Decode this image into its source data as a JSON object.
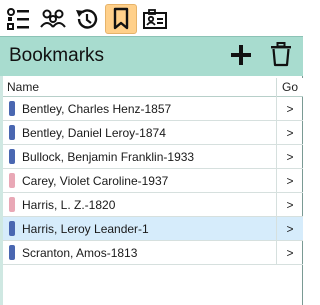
{
  "tabs": [
    {
      "icon": "list-icon"
    },
    {
      "icon": "people-icon"
    },
    {
      "icon": "history-icon"
    },
    {
      "icon": "bookmark-icon",
      "active": true
    },
    {
      "icon": "id-card-icon"
    }
  ],
  "header": {
    "title": "Bookmarks",
    "add_icon": "plus-icon",
    "delete_icon": "trash-icon"
  },
  "table": {
    "columns": [
      "Name",
      "Go"
    ],
    "rows": [
      {
        "label": "Bentley, Charles Henz-1857",
        "color": "#4a67b1",
        "go": ">"
      },
      {
        "label": "Bentley, Daniel Leroy-1874",
        "color": "#4a67b1",
        "go": ">"
      },
      {
        "label": "Bullock, Benjamin Franklin-1933",
        "color": "#4a67b1",
        "go": ">"
      },
      {
        "label": "Carey, Violet Caroline-1937",
        "color": "#e9a8b6",
        "go": ">"
      },
      {
        "label": "Harris, L. Z.-1820",
        "color": "#e9a8b6",
        "go": ">"
      },
      {
        "label": "Harris, Leroy Leander-1",
        "color": "#4a67b1",
        "go": ">",
        "selected": true
      },
      {
        "label": "Scranton, Amos-1813",
        "color": "#4a67b1",
        "go": ">"
      }
    ]
  },
  "colors": {
    "header_bg": "#a8dccf",
    "active_tab": "#ffd08a",
    "selected_row": "#d6ecfb"
  }
}
